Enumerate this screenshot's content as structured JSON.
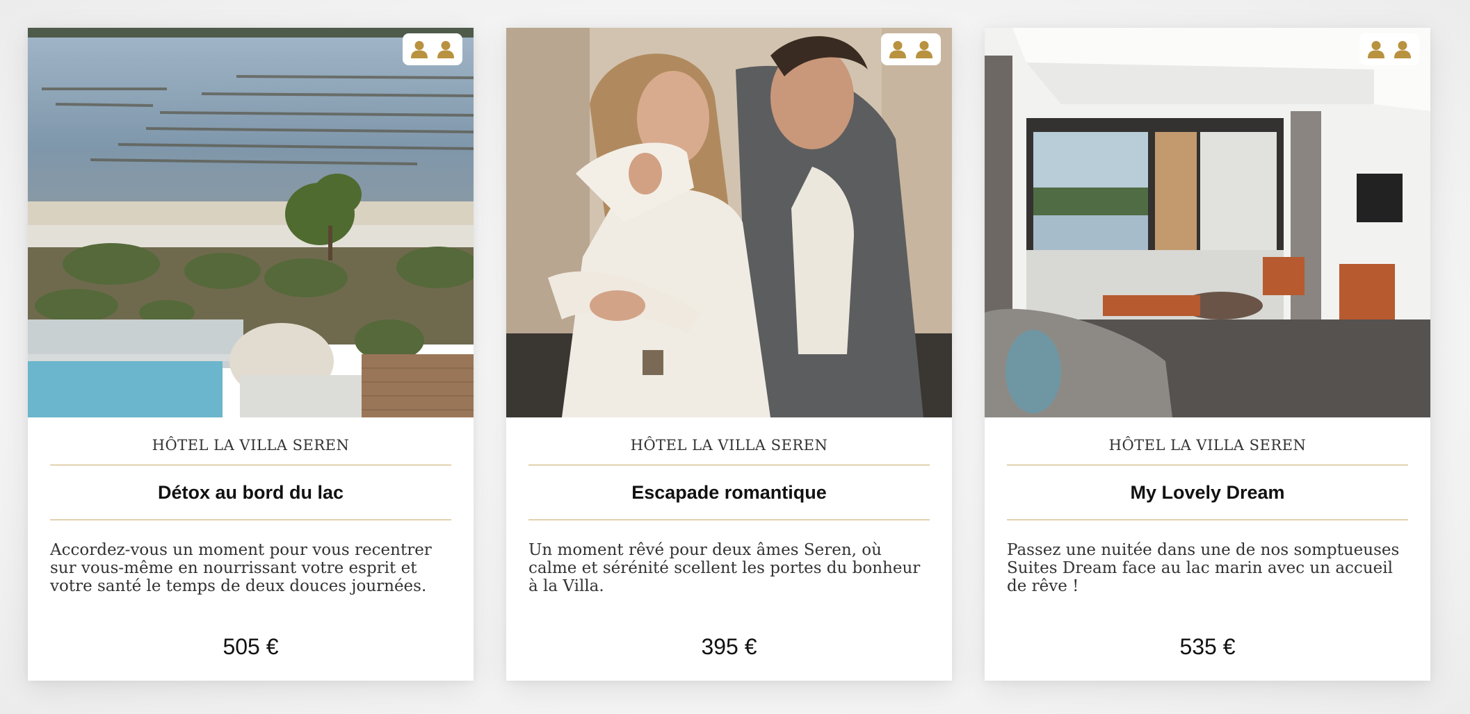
{
  "colors": {
    "accent": "#c9a968",
    "icon": "#b8923f",
    "text": "#111111"
  },
  "cards": [
    {
      "hotel": "HÔTEL LA VILLA SEREN",
      "title": "Détox au bord du lac",
      "description": "Accordez-vous un moment pour vous recentrer sur vous-même en nourrissant votre esprit et votre santé le temps de deux douces journées.",
      "price": "505 €",
      "guests_icon": "two-persons-icon",
      "photo": "lake-view-photo"
    },
    {
      "hotel": "HÔTEL LA VILLA SEREN",
      "title": "Escapade romantique",
      "description": "Un moment rêvé pour deux âmes Seren, où calme et sérénité scellent les portes du bonheur à la Villa.",
      "price": "395 €",
      "guests_icon": "two-persons-icon",
      "photo": "couple-photo"
    },
    {
      "hotel": "HÔTEL LA VILLA SEREN",
      "title": "My Lovely Dream",
      "description": "Passez une nuitée dans une de nos somptueuses Suites Dream face au lac marin avec un accueil de rêve !",
      "price": "535 €",
      "guests_icon": "two-persons-icon",
      "photo": "suite-room-photo"
    }
  ]
}
